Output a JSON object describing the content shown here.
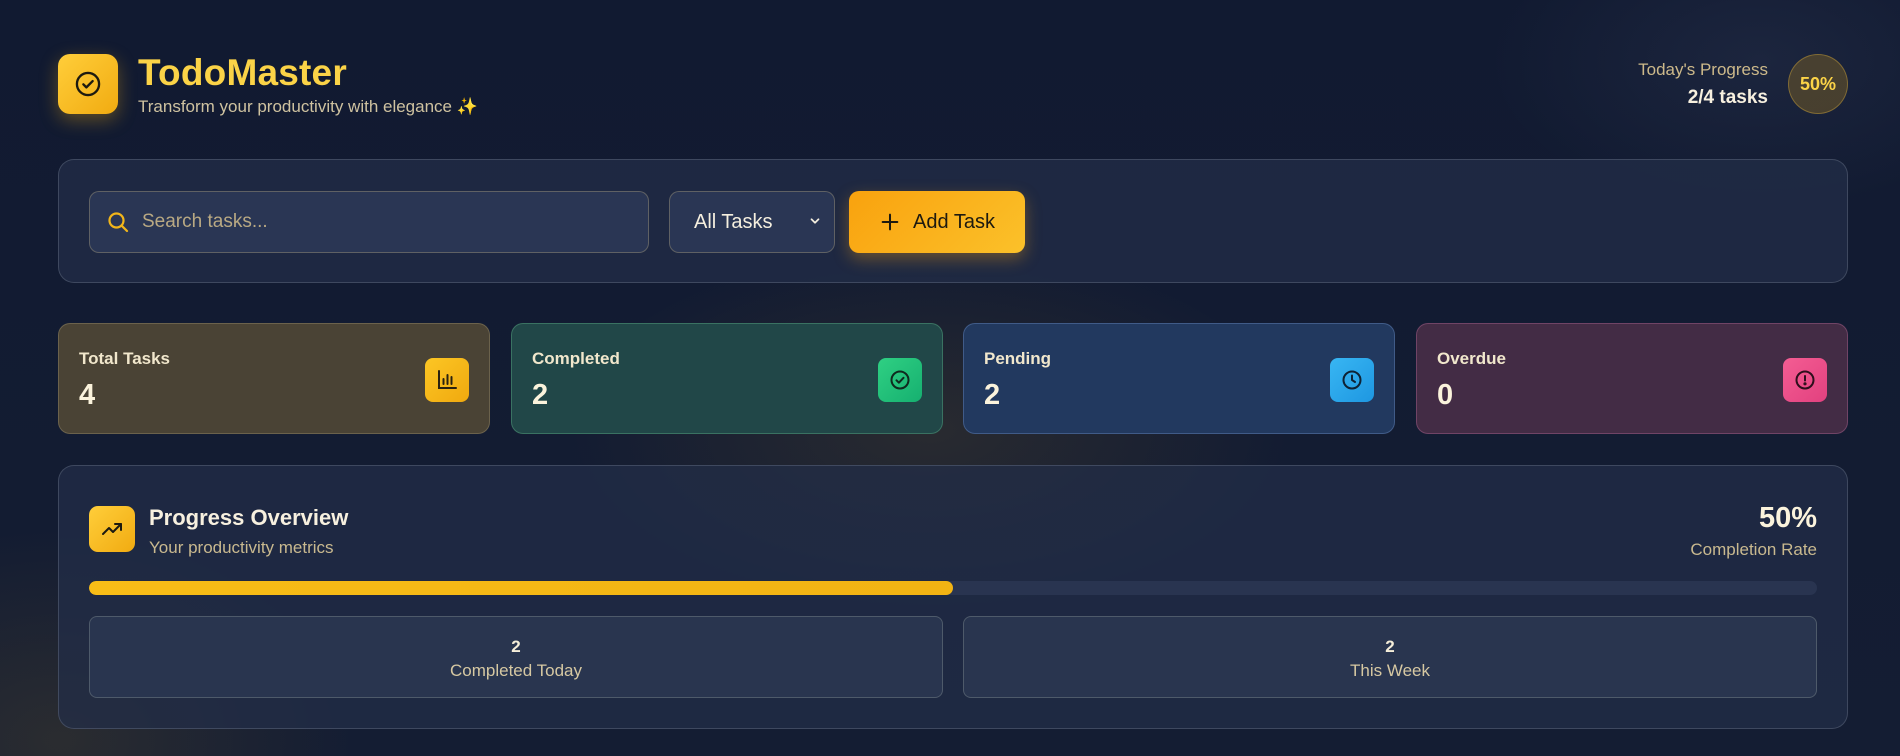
{
  "app": {
    "title": "TodoMaster",
    "subtitle": "Transform your productivity with elegance ✨",
    "accent": "#fbd347"
  },
  "today_progress": {
    "label": "Today's Progress",
    "tasks": "2/4 tasks",
    "percent": "50%"
  },
  "toolbar": {
    "search_placeholder": "Search tasks...",
    "filter_selected": "All Tasks",
    "add_label": "Add Task"
  },
  "stats": [
    {
      "label": "Total Tasks",
      "value": "4",
      "icon": "bar-chart-icon",
      "color": "#f5b916"
    },
    {
      "label": "Completed",
      "value": "2",
      "icon": "check-circle-icon",
      "color": "#22c07a"
    },
    {
      "label": "Pending",
      "value": "2",
      "icon": "clock-icon",
      "color": "#2aa7ec"
    },
    {
      "label": "Overdue",
      "value": "0",
      "icon": "alert-circle-icon",
      "color": "#ee4f8a"
    }
  ],
  "overview": {
    "title": "Progress Overview",
    "subtitle": "Your productivity metrics",
    "percent": "50%",
    "percent_label": "Completion Rate",
    "progress": 0.5,
    "metrics": [
      {
        "value": "2",
        "label": "Completed Today"
      },
      {
        "value": "2",
        "label": "This Week"
      }
    ]
  }
}
